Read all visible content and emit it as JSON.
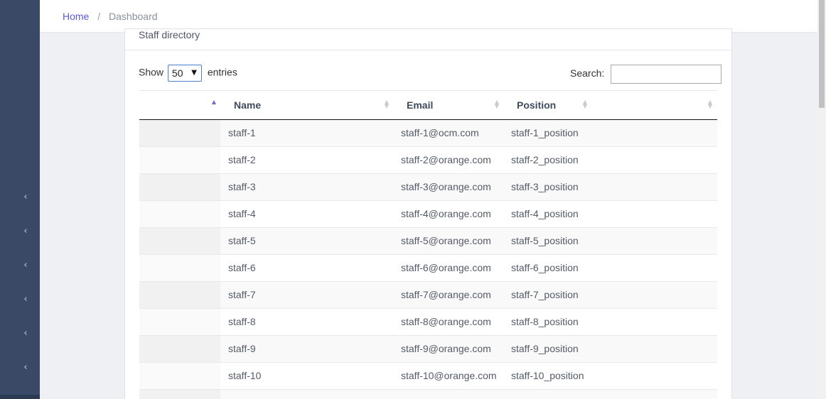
{
  "breadcrumb": {
    "home": "Home",
    "separator": "/",
    "current": "Dashboard"
  },
  "card": {
    "title": "Staff directory"
  },
  "length": {
    "show_label": "Show",
    "value": "50",
    "entries_label": "entries"
  },
  "search": {
    "label": "Search:",
    "value": ""
  },
  "table": {
    "columns": [
      "",
      "Name",
      "Email",
      "Position"
    ],
    "sorted_column": 0,
    "rows": [
      {
        "name": "staff-1",
        "email": "staff-1@ocm.com",
        "position": "staff-1_position"
      },
      {
        "name": "staff-2",
        "email": "staff-2@orange.com",
        "position": "staff-2_position"
      },
      {
        "name": "staff-3",
        "email": "staff-3@orange.com",
        "position": "staff-3_position"
      },
      {
        "name": "staff-4",
        "email": "staff-4@orange.com",
        "position": "staff-4_position"
      },
      {
        "name": "staff-5",
        "email": "staff-5@orange.com",
        "position": "staff-5_position"
      },
      {
        "name": "staff-6",
        "email": "staff-6@orange.com",
        "position": "staff-6_position"
      },
      {
        "name": "staff-7",
        "email": "staff-7@orange.com",
        "position": "staff-7_position"
      },
      {
        "name": "staff-8",
        "email": "staff-8@orange.com",
        "position": "staff-8_position"
      },
      {
        "name": "staff-9",
        "email": "staff-9@orange.com",
        "position": "staff-9_position"
      },
      {
        "name": "staff-10",
        "email": "staff-10@orange.com",
        "position": "staff-10_position"
      },
      {
        "name": "",
        "email": "",
        "position": ""
      }
    ]
  },
  "sidebar": {
    "icons": [
      "chevron-left-icon",
      "chevron-left-icon",
      "chevron-left-icon",
      "chevron-left-icon",
      "chevron-left-icon",
      "chevron-left-icon"
    ]
  },
  "colors": {
    "sidebar": "#3a4a66",
    "link": "#5a5ad1",
    "sort_active": "#6b6fc9"
  }
}
